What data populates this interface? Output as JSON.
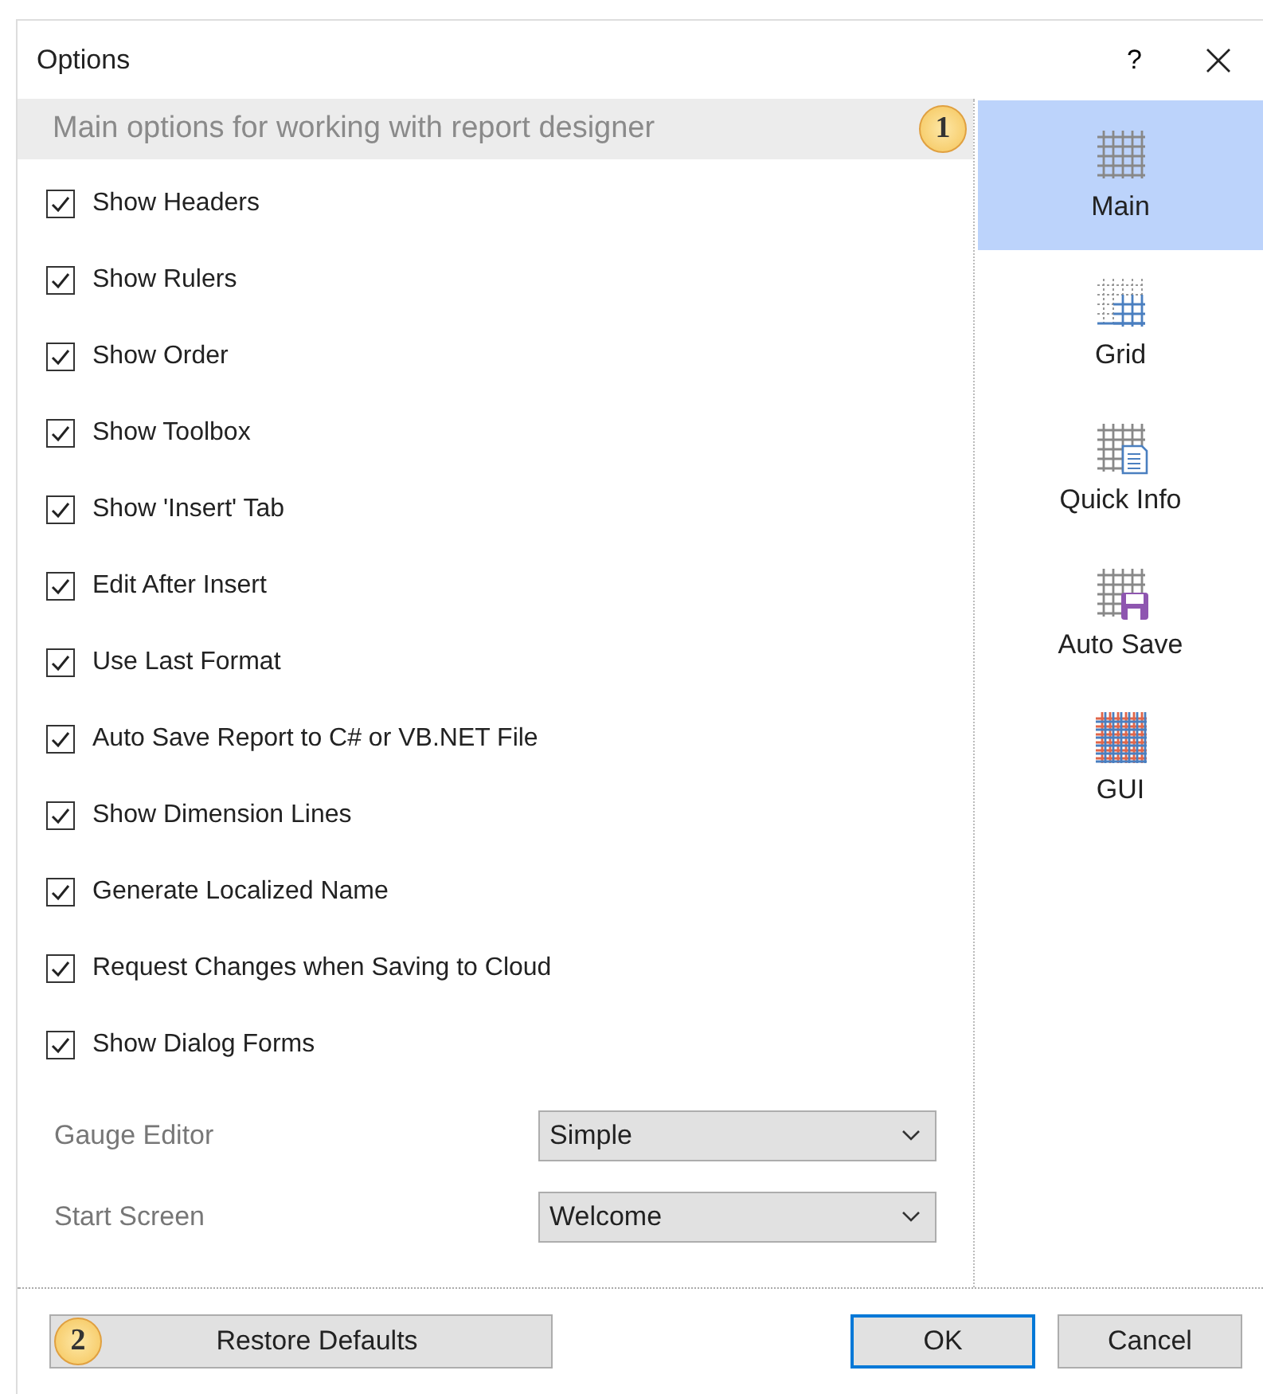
{
  "window": {
    "title": "Options",
    "help": "?"
  },
  "header": {
    "text": "Main options for working with report designer",
    "badge": "1"
  },
  "options": [
    {
      "label": "Show Headers",
      "checked": true
    },
    {
      "label": "Show Rulers",
      "checked": true
    },
    {
      "label": "Show Order",
      "checked": true
    },
    {
      "label": "Show Toolbox",
      "checked": true
    },
    {
      "label": "Show 'Insert' Tab",
      "checked": true
    },
    {
      "label": "Edit After Insert",
      "checked": true
    },
    {
      "label": "Use Last Format",
      "checked": true
    },
    {
      "label": "Auto Save Report to C# or VB.NET File",
      "checked": true
    },
    {
      "label": "Show Dimension Lines",
      "checked": true
    },
    {
      "label": "Generate Localized Name",
      "checked": true
    },
    {
      "label": "Request Changes when Saving to Cloud",
      "checked": true
    },
    {
      "label": "Show Dialog Forms",
      "checked": true
    }
  ],
  "settings": [
    {
      "label": "Gauge Editor",
      "value": "Simple"
    },
    {
      "label": "Start Screen",
      "value": "Welcome"
    }
  ],
  "sidebar": {
    "items": [
      {
        "label": "Main",
        "kind": "plain",
        "selected": true
      },
      {
        "label": "Grid",
        "kind": "grid",
        "selected": false
      },
      {
        "label": "Quick Info",
        "kind": "info",
        "selected": false
      },
      {
        "label": "Auto Save",
        "kind": "save",
        "selected": false
      },
      {
        "label": "GUI",
        "kind": "gui",
        "selected": false
      }
    ]
  },
  "footer": {
    "restore": {
      "label": "Restore Defaults",
      "badge": "2"
    },
    "buttons": [
      {
        "label": "OK",
        "kind": "default"
      },
      {
        "label": "Cancel",
        "kind": "normal"
      }
    ]
  }
}
